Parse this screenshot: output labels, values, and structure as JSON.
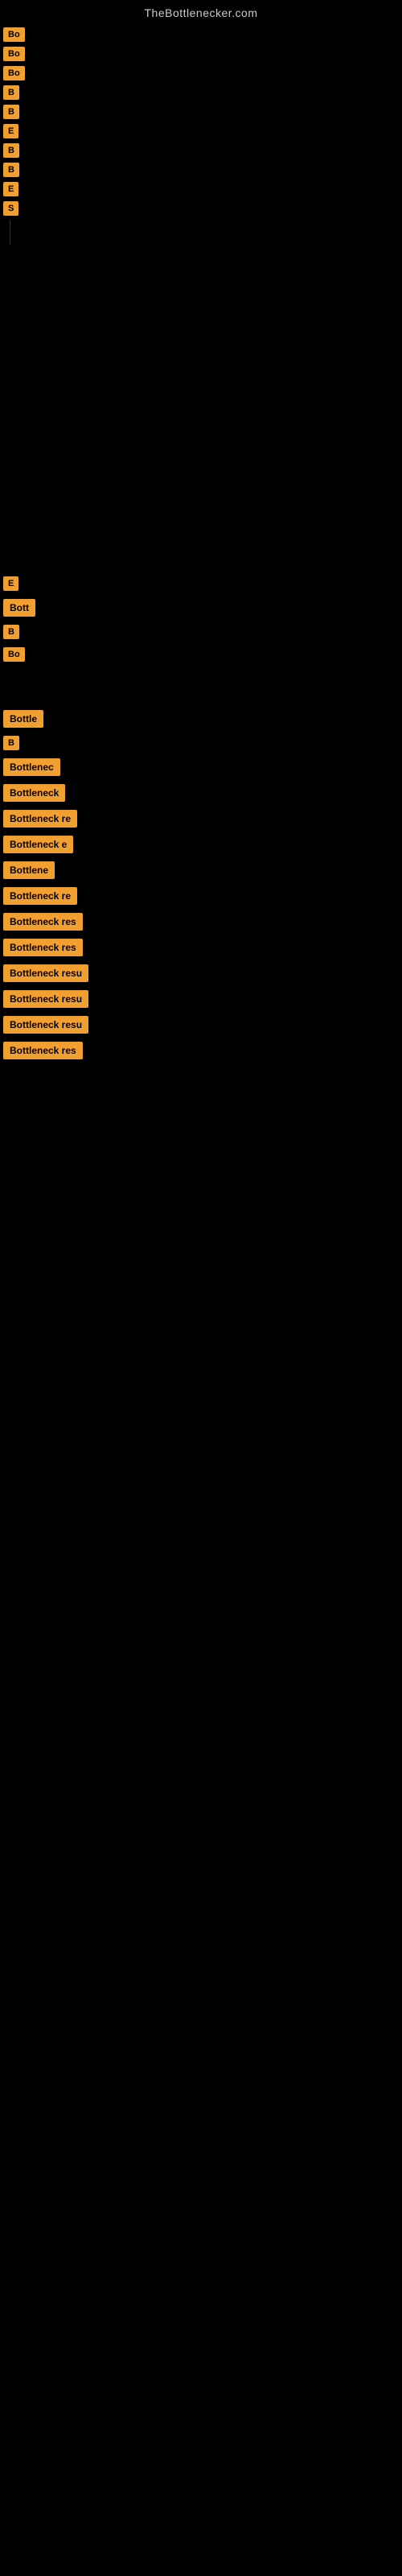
{
  "site": {
    "title": "TheBottlenecker.com"
  },
  "buttons": [
    {
      "id": "btn1",
      "label": "Bo"
    },
    {
      "id": "btn2",
      "label": "Bo"
    },
    {
      "id": "btn3",
      "label": "Bo"
    },
    {
      "id": "btn4",
      "label": "B"
    },
    {
      "id": "btn5",
      "label": "B"
    },
    {
      "id": "btn6",
      "label": "E"
    },
    {
      "id": "btn7",
      "label": "B"
    },
    {
      "id": "btn8",
      "label": "B"
    },
    {
      "id": "btn9",
      "label": "E"
    },
    {
      "id": "btn10",
      "label": "S"
    },
    {
      "id": "btn11",
      "label": "E"
    },
    {
      "id": "btn12",
      "label": "Bott"
    },
    {
      "id": "btn13",
      "label": "B"
    },
    {
      "id": "btn14",
      "label": "Bo"
    },
    {
      "id": "btn15",
      "label": "Bottle"
    },
    {
      "id": "btn16",
      "label": "B"
    },
    {
      "id": "btn17",
      "label": "Bottlenec"
    },
    {
      "id": "btn18",
      "label": "Bottleneck"
    },
    {
      "id": "btn19",
      "label": "Bottleneck re"
    },
    {
      "id": "btn20",
      "label": "Bottleneck e"
    },
    {
      "id": "btn21",
      "label": "Bottlene"
    },
    {
      "id": "btn22",
      "label": "Bottleneck re"
    },
    {
      "id": "btn23",
      "label": "Bottleneck res"
    },
    {
      "id": "btn24",
      "label": "Bottleneck res"
    },
    {
      "id": "btn25",
      "label": "Bottleneck resu"
    },
    {
      "id": "btn26",
      "label": "Bottleneck resu"
    },
    {
      "id": "btn27",
      "label": "Bottleneck resu"
    },
    {
      "id": "btn28",
      "label": "Bottleneck res"
    }
  ]
}
